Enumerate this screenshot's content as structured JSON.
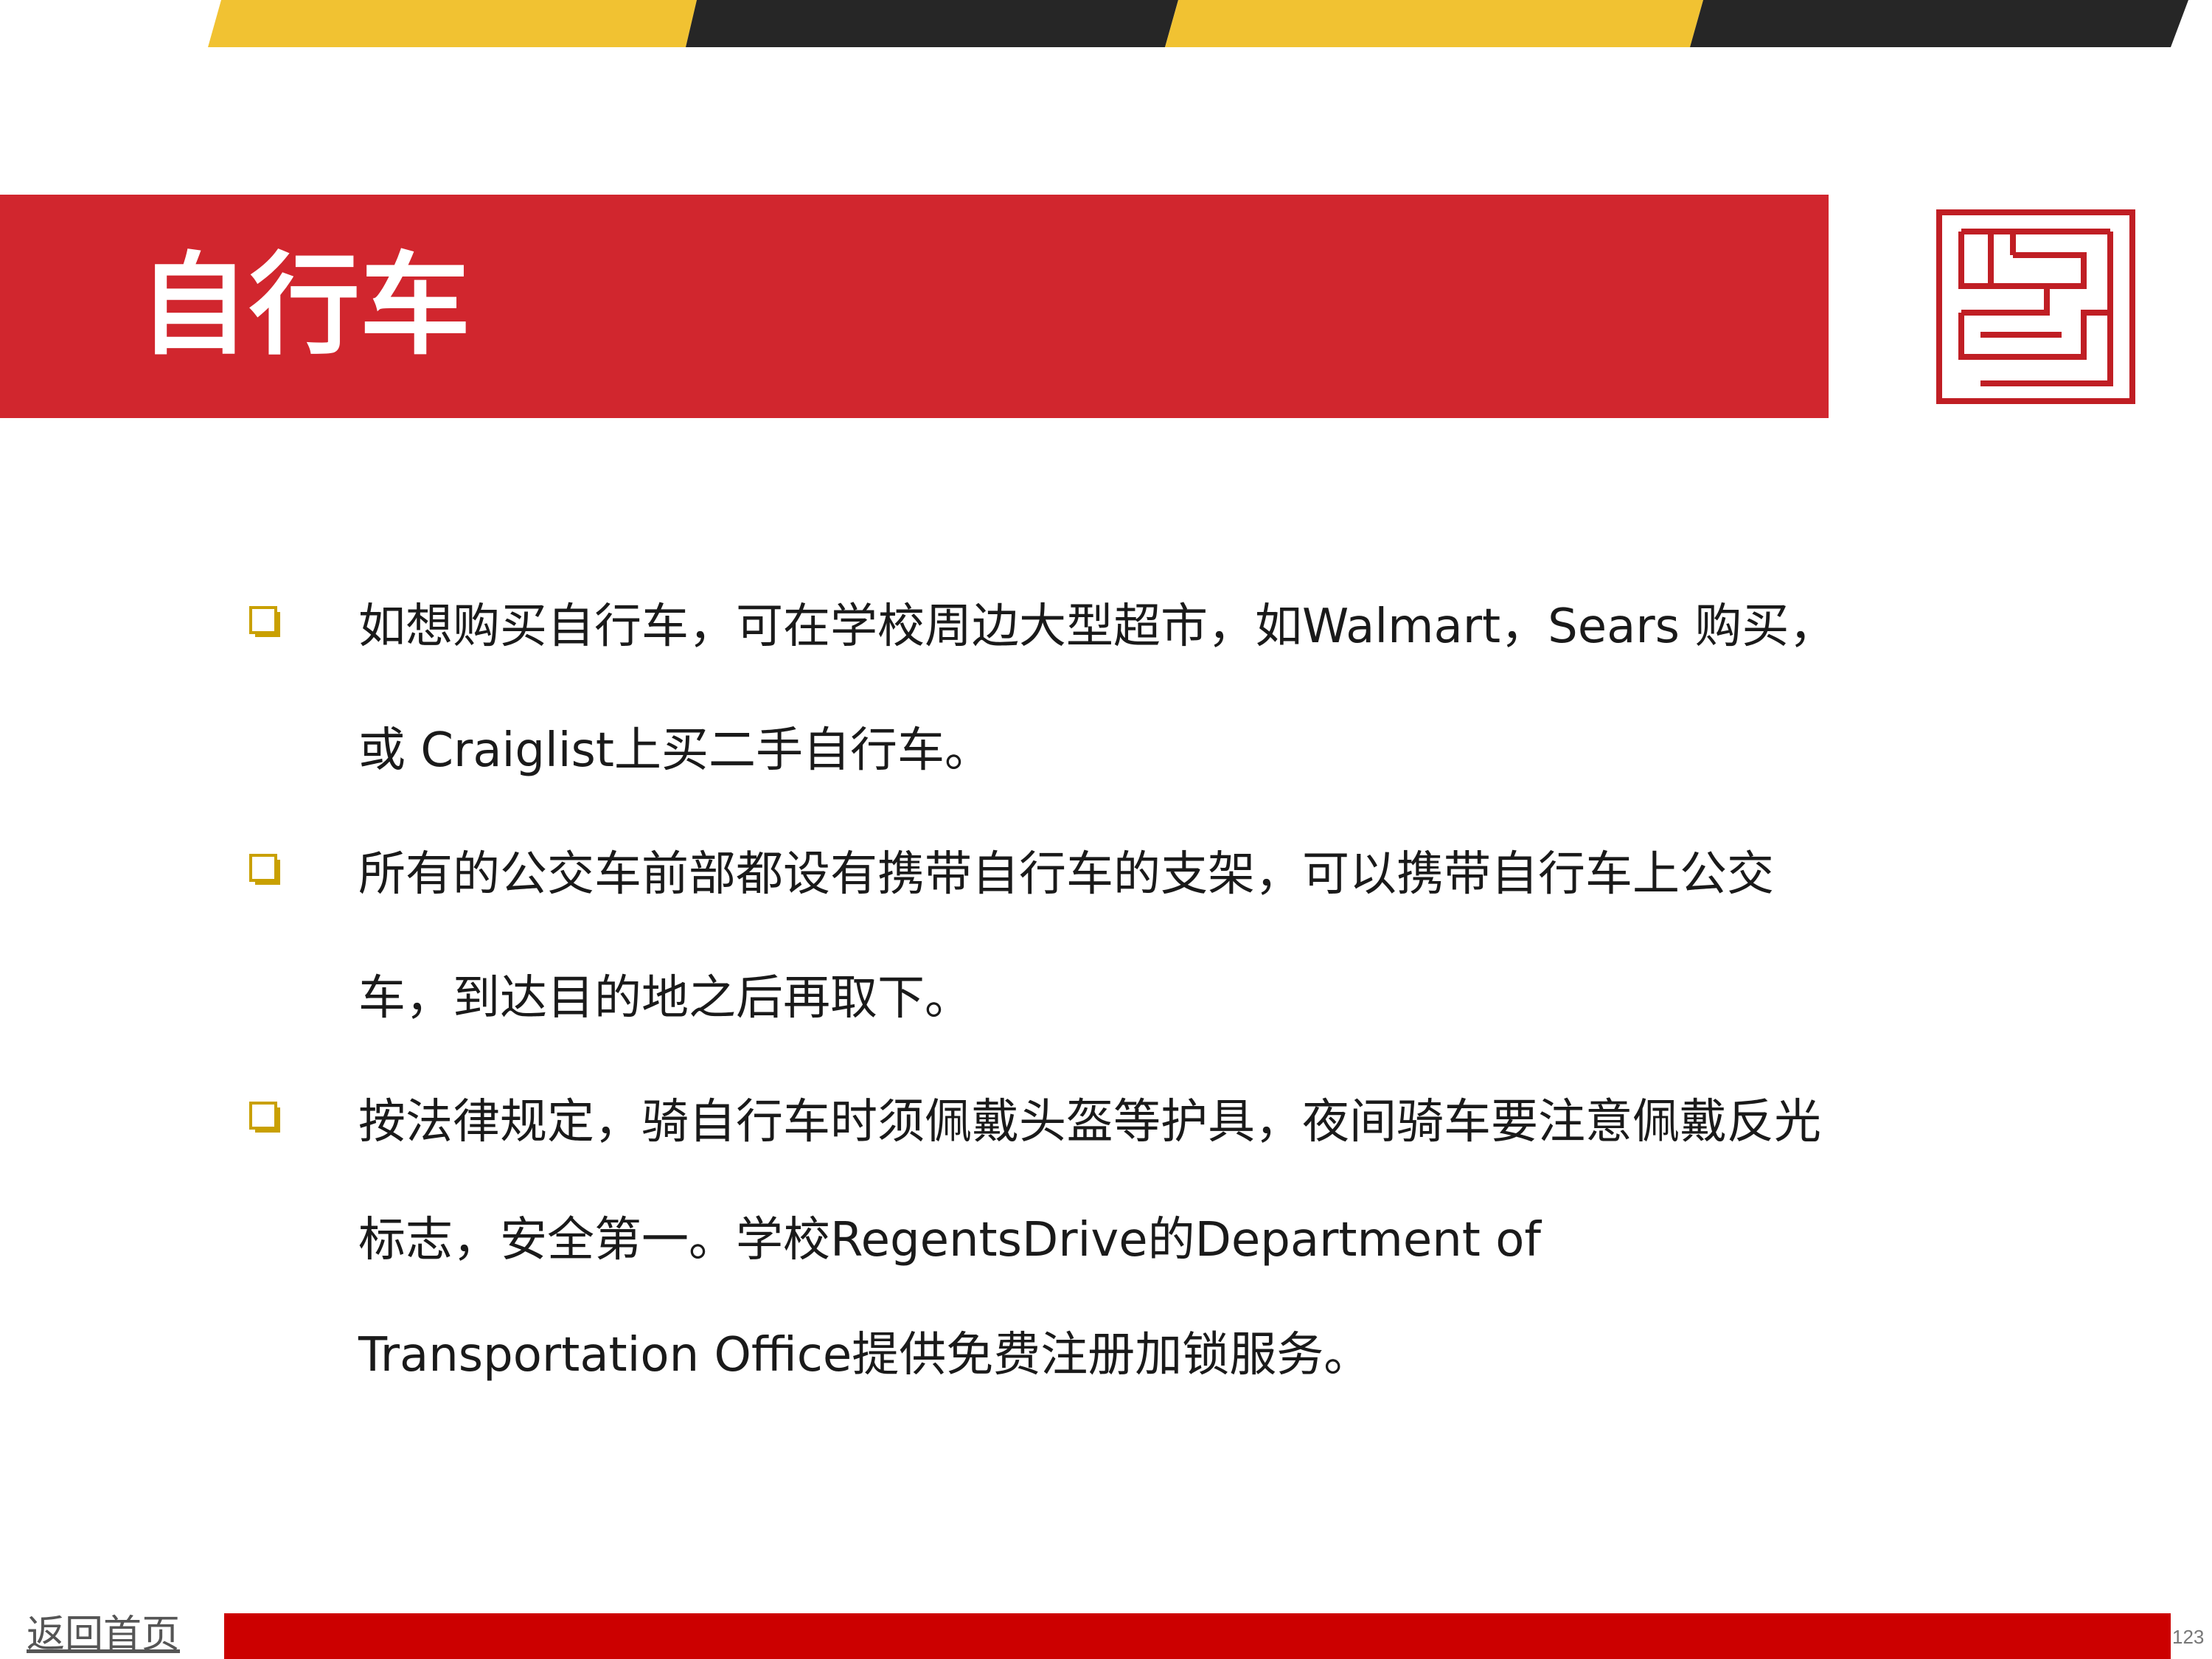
{
  "title": "自行车",
  "colors": {
    "accent_red": "#D1262E",
    "accent_yellow": "#F1C232",
    "stripe_dark": "#262626",
    "footer_red": "#CC0000",
    "bullet_gold": "#C9A000"
  },
  "bullets": [
    {
      "icon": "square-bullet-icon",
      "lines": [
        "如想购买自行车，可在学校周边大型超市，如Walmart，Sears 购买，",
        "或 Craiglist上买二手自行车。"
      ]
    },
    {
      "icon": "square-bullet-icon",
      "lines": [
        "所有的公交车前部都设有携带自行车的支架，可以携带自行车上公交",
        "车，到达目的地之后再取下。"
      ]
    },
    {
      "icon": "square-bullet-icon",
      "lines": [
        "按法律规定，骑自行车时须佩戴头盔等护具，夜间骑车要注意佩戴反光",
        "标志，安全第一。学校RegentsDrive的Department of",
        "Transportation Office提供免费注册加锁服务。"
      ]
    }
  ],
  "footer": {
    "home_link": "返回首页",
    "page_number": "123"
  },
  "logo": "seal-logo-icon"
}
